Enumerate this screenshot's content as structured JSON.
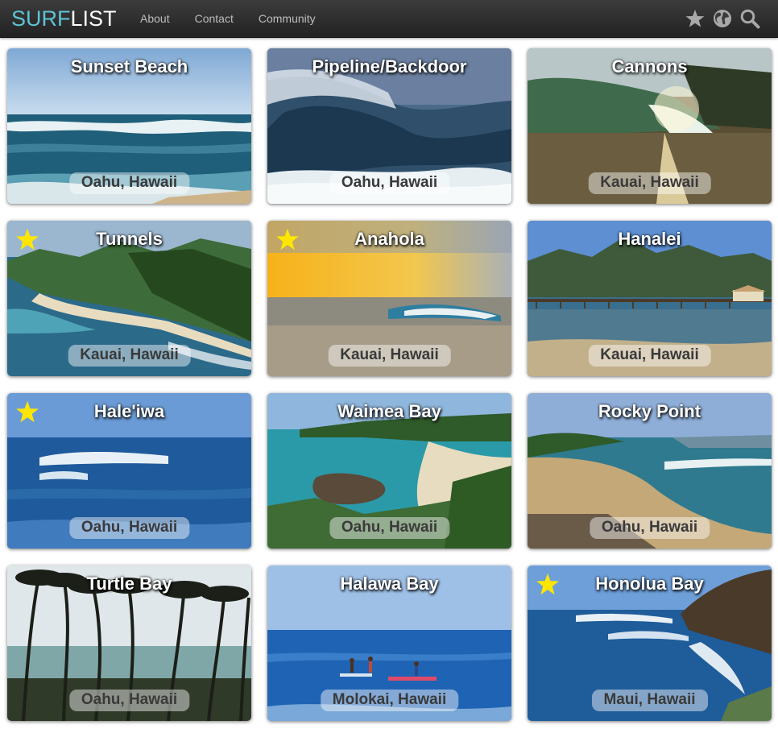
{
  "brand": {
    "part1": "SURF",
    "part2": "LIST"
  },
  "nav": {
    "links": [
      "About",
      "Contact",
      "Community"
    ],
    "icons": [
      "star-icon",
      "globe-icon",
      "search-icon"
    ]
  },
  "colors": {
    "brand_accent": "#5ec4d6",
    "navbar": "#2b2b2b",
    "favorite_star": "#ffe600"
  },
  "spots": [
    {
      "name": "Sunset Beach",
      "location": "Oahu, Hawaii",
      "favorite": false
    },
    {
      "name": "Pipeline/Backdoor",
      "location": "Oahu, Hawaii",
      "favorite": false
    },
    {
      "name": "Cannons",
      "location": "Kauai, Hawaii",
      "favorite": false
    },
    {
      "name": "Tunnels",
      "location": "Kauai, Hawaii",
      "favorite": true
    },
    {
      "name": "Anahola",
      "location": "Kauai, Hawaii",
      "favorite": true
    },
    {
      "name": "Hanalei",
      "location": "Kauai, Hawaii",
      "favorite": false
    },
    {
      "name": "Hale'iwa",
      "location": "Oahu, Hawaii",
      "favorite": true
    },
    {
      "name": "Waimea Bay",
      "location": "Oahu, Hawaii",
      "favorite": false
    },
    {
      "name": "Rocky Point",
      "location": "Oahu, Hawaii",
      "favorite": false
    },
    {
      "name": "Turtle Bay",
      "location": "Oahu, Hawaii",
      "favorite": false
    },
    {
      "name": "Halawa Bay",
      "location": "Molokai, Hawaii",
      "favorite": false
    },
    {
      "name": "Honolua Bay",
      "location": "Maui, Hawaii",
      "favorite": true
    }
  ]
}
